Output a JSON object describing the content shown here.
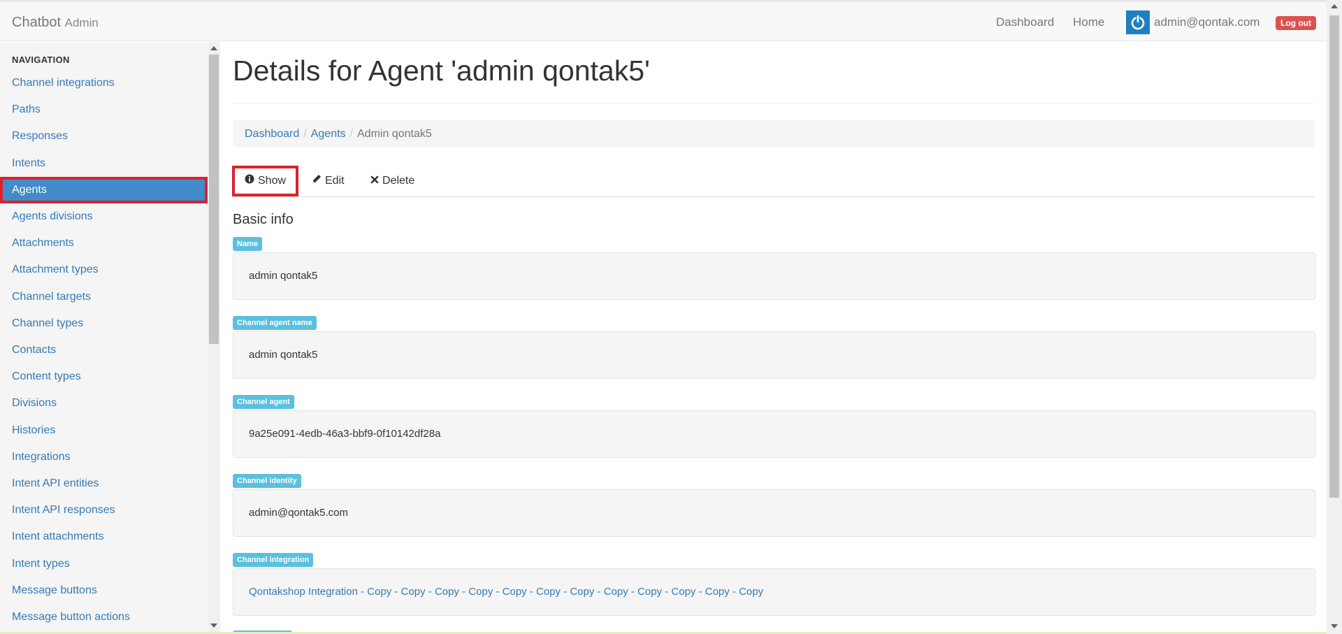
{
  "navbar": {
    "brand": "Chatbot",
    "brand_sub": "Admin",
    "links": [
      "Dashboard",
      "Home"
    ],
    "user_email": "admin@qontak.com",
    "logout_label": "Log out"
  },
  "sidebar": {
    "header": "NAVIGATION",
    "active_index": 4,
    "items": [
      "Channel integrations",
      "Paths",
      "Responses",
      "Intents",
      "Agents",
      "Agents divisions",
      "Attachments",
      "Attachment types",
      "Channel targets",
      "Channel types",
      "Contacts",
      "Content types",
      "Divisions",
      "Histories",
      "Integrations",
      "Intent API entities",
      "Intent API responses",
      "Intent attachments",
      "Intent types",
      "Message buttons",
      "Message button actions"
    ]
  },
  "main": {
    "title": "Details for Agent 'admin qontak5'",
    "breadcrumb": [
      {
        "label": "Dashboard",
        "link": true
      },
      {
        "label": "Agents",
        "link": true
      },
      {
        "label": "Admin qontak5",
        "link": false
      }
    ],
    "tabs": [
      {
        "label": "Show",
        "icon": "info-icon",
        "active": true
      },
      {
        "label": "Edit",
        "icon": "pencil-icon",
        "active": false
      },
      {
        "label": "Delete",
        "icon": "times-icon",
        "active": false
      }
    ],
    "section_title": "Basic info",
    "fields": [
      {
        "label": "Name",
        "value": "admin qontak5",
        "link": false
      },
      {
        "label": "Channel agent name",
        "value": "admin qontak5",
        "link": false
      },
      {
        "label": "Channel agent",
        "value": "9a25e091-4edb-46a3-bbf9-0f10142df28a",
        "link": false
      },
      {
        "label": "Channel identity",
        "value": "admin@qontak5.com",
        "link": false
      },
      {
        "label": "Channel integration",
        "value": "Qontakshop Integration - Copy - Copy - Copy - Copy - Copy - Copy - Copy - Copy - Copy - Copy - Copy - Copy",
        "link": true
      }
    ]
  },
  "colors": {
    "accent": "#337ab7",
    "active_bg": "#428bca",
    "highlight_border": "#d9232c",
    "label_bg": "#5bc0de",
    "danger": "#d9534f"
  }
}
